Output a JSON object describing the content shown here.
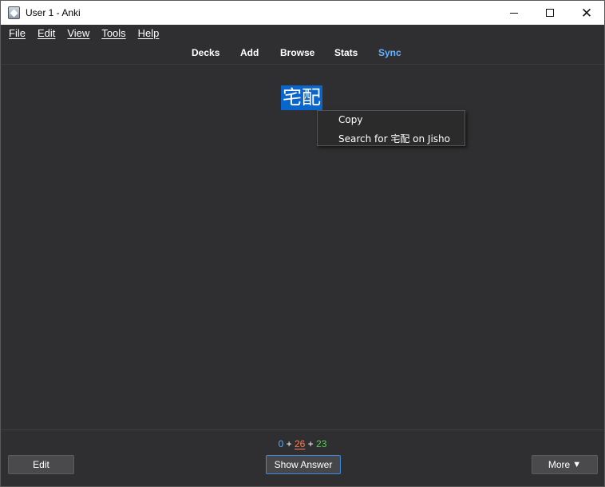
{
  "window": {
    "title": "User 1 - Anki",
    "app_icon": "anki-icon",
    "controls": {
      "minimize": "minimize-icon",
      "maximize": "maximize-icon",
      "close": "✕"
    }
  },
  "menubar": {
    "items": [
      "File",
      "Edit",
      "View",
      "Tools",
      "Help"
    ]
  },
  "toolbar": {
    "items": [
      "Decks",
      "Add",
      "Browse",
      "Stats",
      "Sync"
    ],
    "sync_color": "#66b2ff"
  },
  "card": {
    "text": "宅配",
    "selection_color": "#0b66cc"
  },
  "context_menu": {
    "items": [
      "Copy",
      "Search for 宅配 on Jisho"
    ]
  },
  "bottom": {
    "counts": {
      "new": "0",
      "sep1": " + ",
      "learn": "26",
      "sep2": " + ",
      "review": "23"
    },
    "colors": {
      "new": "#55aaff",
      "learn": "#ff7c54",
      "review": "#4ed14e"
    },
    "edit_label": "Edit",
    "show_answer_label": "Show Answer",
    "more_label": "More",
    "more_icon": "▼"
  }
}
